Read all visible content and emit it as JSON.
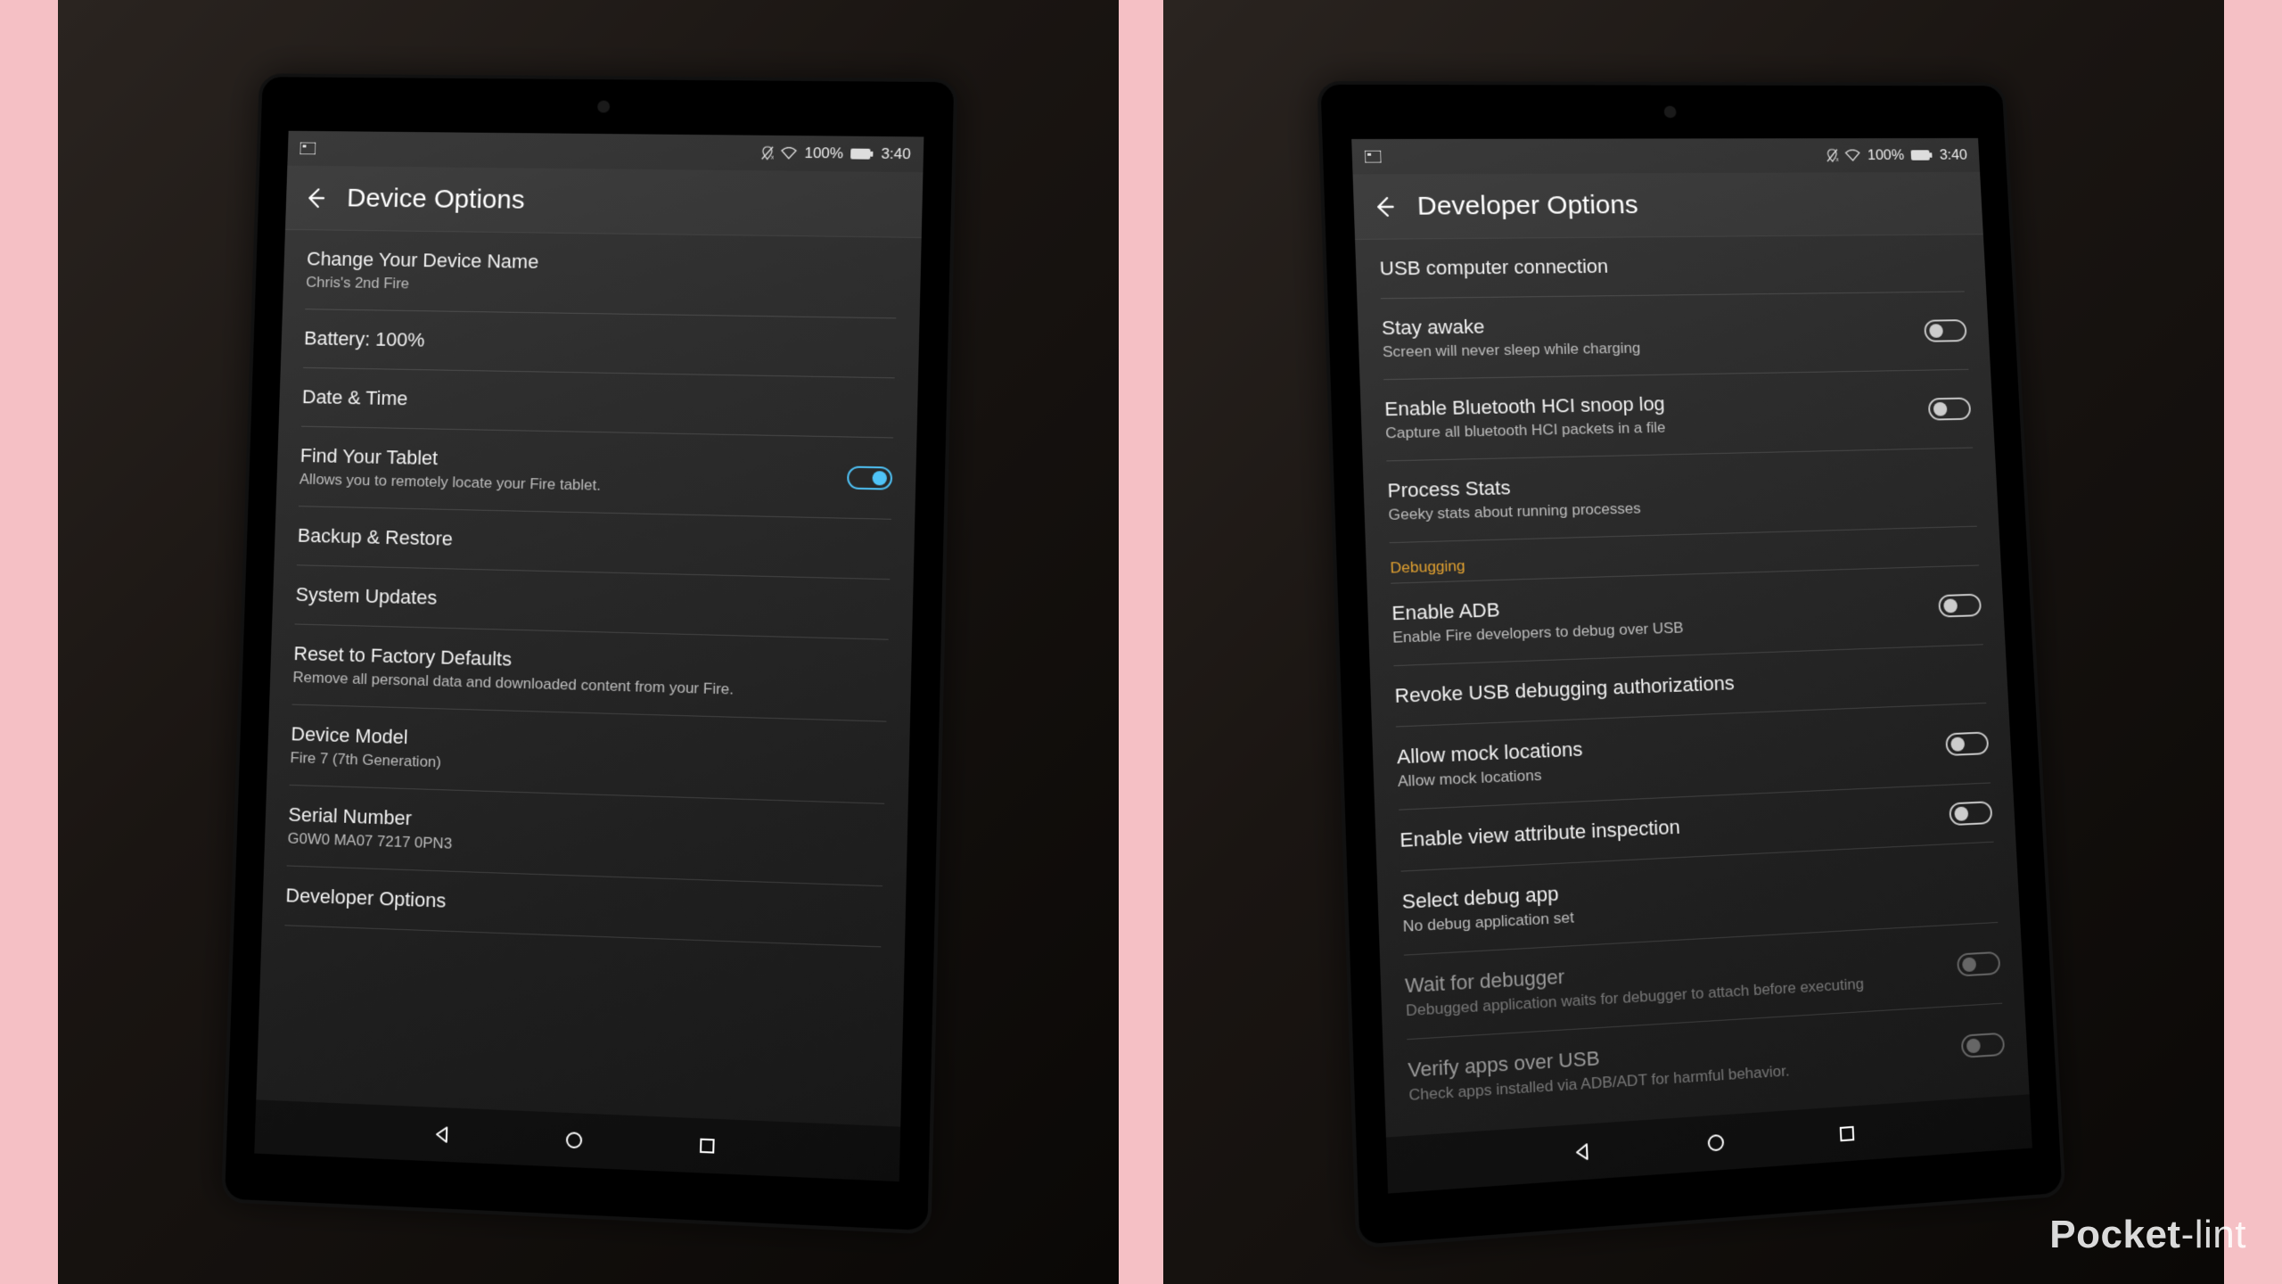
{
  "watermark": {
    "bold": "Pocket",
    "light": "-lint"
  },
  "statusbar": {
    "battery": "100%",
    "time": "3:40"
  },
  "nav": {
    "back": "◁",
    "home": "○",
    "recent": "□"
  },
  "left": {
    "header": "Device Options",
    "items": [
      {
        "title": "Change Your Device Name",
        "sub": "Chris's 2nd Fire"
      },
      {
        "title": "Battery: 100%"
      },
      {
        "title": "Date & Time"
      },
      {
        "title": "Find Your Tablet",
        "sub": "Allows you to remotely locate your Fire tablet.",
        "toggle": "on"
      },
      {
        "title": "Backup & Restore"
      },
      {
        "title": "System Updates"
      },
      {
        "title": "Reset to Factory Defaults",
        "sub": "Remove all personal data and downloaded content from your Fire."
      },
      {
        "title": "Device Model",
        "sub": "Fire 7 (7th Generation)"
      },
      {
        "title": "Serial Number",
        "sub": "G0W0 MA07 7217 0PN3"
      },
      {
        "title": "Developer Options"
      }
    ]
  },
  "right": {
    "header": "Developer Options",
    "items": [
      {
        "title": "USB computer connection"
      },
      {
        "title": "Stay awake",
        "sub": "Screen will never sleep while charging",
        "toggle": "off"
      },
      {
        "title": "Enable Bluetooth HCI snoop log",
        "sub": "Capture all bluetooth HCI packets in a file",
        "toggle": "off"
      },
      {
        "title": "Process Stats",
        "sub": "Geeky stats about running processes"
      }
    ],
    "section": "Debugging",
    "items2": [
      {
        "title": "Enable ADB",
        "sub": "Enable Fire developers to debug over USB",
        "toggle": "off"
      },
      {
        "title": "Revoke USB debugging authorizations"
      },
      {
        "title": "Allow mock locations",
        "sub": "Allow mock locations",
        "toggle": "off"
      },
      {
        "title": "Enable view attribute inspection",
        "toggle": "off"
      },
      {
        "title": "Select debug app",
        "sub": "No debug application set"
      },
      {
        "title": "Wait for debugger",
        "sub": "Debugged application waits for debugger to attach before executing",
        "toggle": "off",
        "dim": true
      },
      {
        "title": "Verify apps over USB",
        "sub": "Check apps installed via ADB/ADT for harmful behavior.",
        "toggle": "off",
        "dim": true
      }
    ]
  }
}
